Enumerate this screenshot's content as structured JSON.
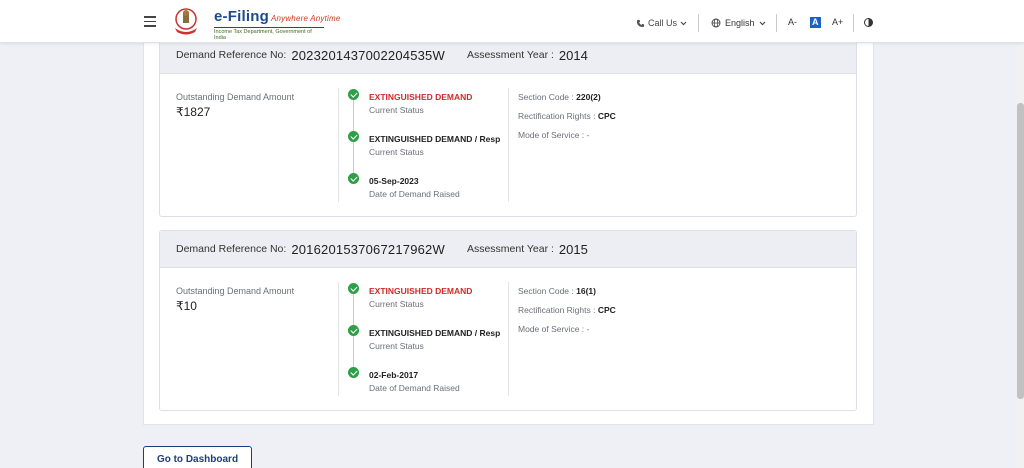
{
  "header": {
    "logo_title": "e-Filing",
    "logo_tagline": "Anywhere Anytime",
    "logo_subtitle": "Income Tax Department, Government of India",
    "call_us": "Call Us",
    "language": "English",
    "font_decrease": "A-",
    "font_default": "A",
    "font_increase": "A+"
  },
  "labels": {
    "demand_ref": "Demand Reference No:",
    "assessment_year": "Assessment Year :",
    "outstanding": "Outstanding Demand Amount",
    "current_status": "Current Status",
    "date_raised": "Date of Demand Raised",
    "section_code": "Section Code :",
    "rectification": "Rectification Rights :",
    "mode_of_service": "Mode of Service :"
  },
  "demands": [
    {
      "ref_no": "2023201437002204535W",
      "assessment_year": "2014",
      "amount": "₹1827",
      "status_1": "EXTINGUISHED DEMAND",
      "status_2": "EXTINGUISHED DEMAND / Resp",
      "date": "05-Sep-2023",
      "section_code": "220(2)",
      "rectification": "CPC",
      "mode_of_service": "-"
    },
    {
      "ref_no": "2016201537067217962W",
      "assessment_year": "2015",
      "amount": "₹10",
      "status_1": "EXTINGUISHED DEMAND",
      "status_2": "EXTINGUISHED DEMAND / Resp",
      "date": "02-Feb-2017",
      "section_code": "16(1)",
      "rectification": "CPC",
      "mode_of_service": "-"
    }
  ],
  "go_dashboard": "Go to Dashboard",
  "colors": {
    "accent": "#1d3e7c",
    "success": "#2e9e47",
    "danger": "#d12a2a"
  },
  "icons": [
    "menu-icon",
    "emblem-icon",
    "phone-icon",
    "globe-icon",
    "chevron-down-icon",
    "check-icon",
    "contrast-icon"
  ]
}
